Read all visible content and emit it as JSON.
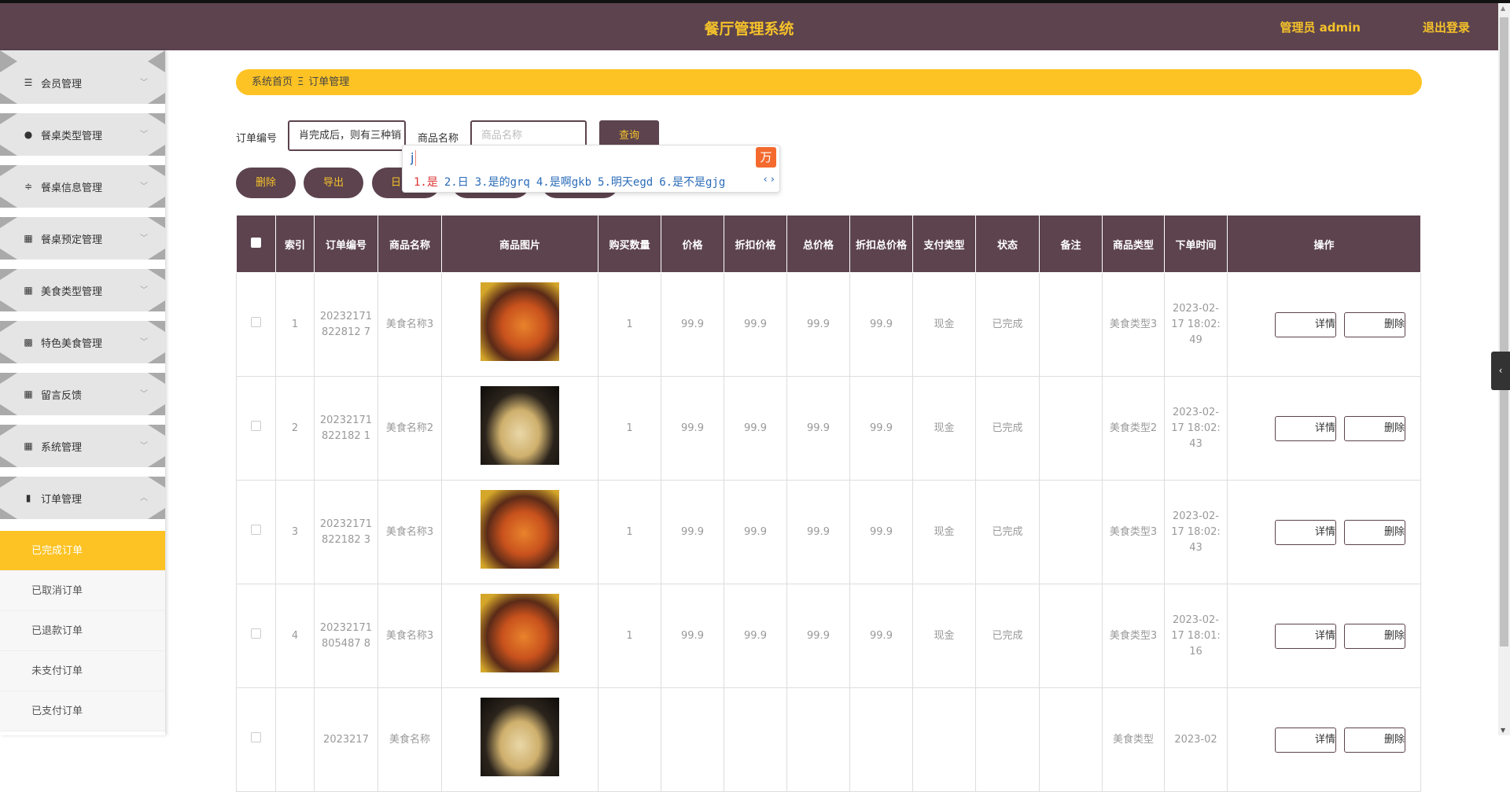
{
  "header": {
    "title": "餐厅管理系统",
    "user": "管理员 admin",
    "logout": "退出登录"
  },
  "sidebar": {
    "menus": [
      {
        "label": "会员管理",
        "icon": "list-icon"
      },
      {
        "label": "餐桌类型管理",
        "icon": "bulb-icon"
      },
      {
        "label": "餐桌信息管理",
        "icon": "sliders-icon"
      },
      {
        "label": "餐桌预定管理",
        "icon": "grid-icon"
      },
      {
        "label": "美食类型管理",
        "icon": "grid-icon"
      },
      {
        "label": "特色美食管理",
        "icon": "grid-9-icon"
      },
      {
        "label": "留言反馈",
        "icon": "grid-icon"
      },
      {
        "label": "系统管理",
        "icon": "grid-icon"
      },
      {
        "label": "订单管理",
        "icon": "ticket-icon"
      }
    ],
    "submenu": [
      "已完成订单",
      "已取消订单",
      "已退款订单",
      "未支付订单",
      "已支付订单"
    ]
  },
  "breadcrumb": {
    "home": "系统首页",
    "sep": "Ξ",
    "current": "订单管理"
  },
  "search": {
    "order_label": "订单编号",
    "order_value": "肖完成后，则有三种销",
    "name_label": "商品名称",
    "name_placeholder": "商品名称",
    "query": "查询"
  },
  "actions": {
    "delete": "删除",
    "export": "导出",
    "third": "日"
  },
  "ime": {
    "composition": "j",
    "candidates": [
      "1.是",
      "2.日",
      "3.是的grq",
      "4.是啊gkb",
      "5.明天egd",
      "6.是不是gjg"
    ]
  },
  "table": {
    "headers": [
      "索引",
      "订单编号",
      "商品名称",
      "商品图片",
      "购买数量",
      "价格",
      "折扣价格",
      "总价格",
      "折扣总价格",
      "支付类型",
      "状态",
      "备注",
      "商品类型",
      "下单时间",
      "操作"
    ],
    "detail": "详情",
    "delete": "删除",
    "rows": [
      {
        "index": "1",
        "order_no": "20232171822812 7",
        "name": "美食名称3",
        "qty": "1",
        "price": "99.9",
        "disc": "99.9",
        "total": "99.9",
        "disc_total": "99.9",
        "pay": "现金",
        "status": "已完成",
        "note": "",
        "type": "美食类型3",
        "time": "2023-02-17 18:02:49",
        "img": "f1"
      },
      {
        "index": "2",
        "order_no": "20232171822182 1",
        "name": "美食名称2",
        "qty": "1",
        "price": "99.9",
        "disc": "99.9",
        "total": "99.9",
        "disc_total": "99.9",
        "pay": "现金",
        "status": "已完成",
        "note": "",
        "type": "美食类型2",
        "time": "2023-02-17 18:02:43",
        "img": "f2"
      },
      {
        "index": "3",
        "order_no": "20232171822182 3",
        "name": "美食名称3",
        "qty": "1",
        "price": "99.9",
        "disc": "99.9",
        "total": "99.9",
        "disc_total": "99.9",
        "pay": "现金",
        "status": "已完成",
        "note": "",
        "type": "美食类型3",
        "time": "2023-02-17 18:02:43",
        "img": "f1"
      },
      {
        "index": "4",
        "order_no": "20232171805487 8",
        "name": "美食名称3",
        "qty": "1",
        "price": "99.9",
        "disc": "99.9",
        "total": "99.9",
        "disc_total": "99.9",
        "pay": "现金",
        "status": "已完成",
        "note": "",
        "type": "美食类型3",
        "time": "2023-02-17 18:01:16",
        "img": "f1"
      },
      {
        "index": "",
        "order_no": "2023217",
        "name": "美食名称",
        "qty": "",
        "price": "",
        "disc": "",
        "total": "",
        "disc_total": "",
        "pay": "",
        "status": "",
        "note": "",
        "type": "美食类型",
        "time": "2023-02",
        "img": "f2"
      }
    ]
  }
}
